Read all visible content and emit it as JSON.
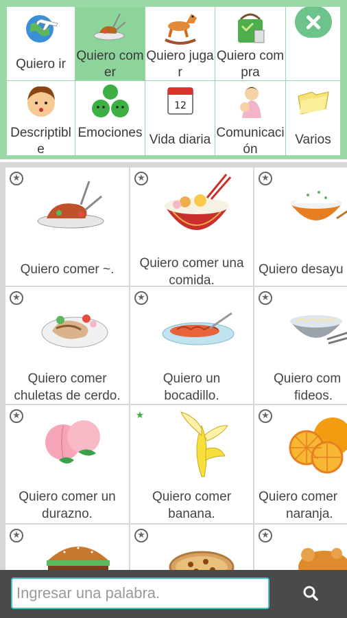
{
  "categories": [
    {
      "label": "Quiero ir",
      "selected": false,
      "icon": "globe-airplane-icon"
    },
    {
      "label": "Quiero comer",
      "selected": true,
      "icon": "food-plate-icon"
    },
    {
      "label": "Quiero jugar",
      "selected": false,
      "icon": "rocking-horse-icon"
    },
    {
      "label": "Quiero compra",
      "selected": false,
      "icon": "shopping-bag-icon"
    },
    {
      "label": "Descriptible",
      "selected": false,
      "icon": "face-icon"
    },
    {
      "label": "Emociones",
      "selected": false,
      "icon": "emotion-faces-icon"
    },
    {
      "label": "Vida diaria",
      "selected": false,
      "icon": "calendar-icon"
    },
    {
      "label": "Comunicación",
      "selected": false,
      "icon": "mother-child-icon"
    },
    {
      "label": "Varios",
      "selected": false,
      "icon": "folders-icon"
    }
  ],
  "close_icon": "close-icon",
  "phrases": [
    {
      "line1": "",
      "line2": "Quiero comer ~.",
      "favorite": false,
      "icon": "roast-meat-icon"
    },
    {
      "line1": "Quiero comer una",
      "line2": "comida.",
      "favorite": false,
      "icon": "rice-bowl-icon"
    },
    {
      "line1": "",
      "line2": "Quiero desayu",
      "favorite": false,
      "icon": "breakfast-rice-icon"
    },
    {
      "line1": "Quiero comer",
      "line2": "chuletas de cerdo.",
      "favorite": false,
      "icon": "pork-chop-icon"
    },
    {
      "line1": "Quiero un",
      "line2": "bocadillo.",
      "favorite": false,
      "icon": "snack-plate-icon"
    },
    {
      "line1": "Quiero com",
      "line2": "fideos.",
      "favorite": false,
      "icon": "noodle-bowl-icon"
    },
    {
      "line1": "Quiero comer un",
      "line2": "durazno.",
      "favorite": false,
      "icon": "peach-icon"
    },
    {
      "line1": "Quiero comer",
      "line2": "banana.",
      "favorite": true,
      "icon": "banana-icon"
    },
    {
      "line1": "Quiero comer",
      "line2": "naranja.",
      "favorite": false,
      "icon": "orange-icon"
    },
    {
      "line1": "",
      "line2": "",
      "favorite": false,
      "icon": "hamburger-icon"
    },
    {
      "line1": "",
      "line2": "",
      "favorite": false,
      "icon": "pizza-icon"
    },
    {
      "line1": "",
      "line2": "",
      "favorite": false,
      "icon": "roast-chicken-icon"
    }
  ],
  "search": {
    "placeholder": "Ingresar una palabra.",
    "value": ""
  },
  "search_icon": "magnifier-icon",
  "colors": {
    "panel": "#9bd9a8",
    "selected": "#8cd49a",
    "accent": "#3fc6c6",
    "bottombar": "#4a4a4a"
  }
}
